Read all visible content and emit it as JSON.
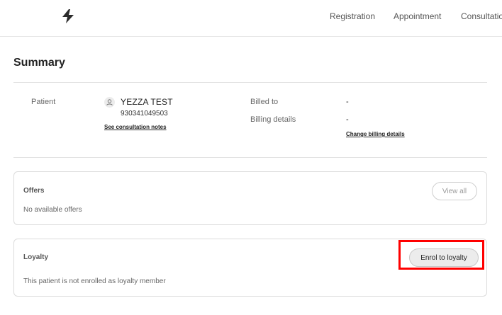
{
  "header": {
    "logo_icon": "lightning-bolt-icon",
    "nav": [
      "Registration",
      "Appointment",
      "Consultation"
    ]
  },
  "summary": {
    "title": "Summary",
    "patient_label": "Patient",
    "patient_name": "YEZZA TEST",
    "patient_id": "930341049503",
    "consultation_link": "See consultation notes",
    "billed_to_label": "Billed to",
    "billed_to_value": "-",
    "billing_details_label": "Billing details",
    "billing_details_value": "-",
    "change_billing_link": "Change billing details"
  },
  "offers": {
    "title": "Offers",
    "button": "View all",
    "empty_text": "No available offers"
  },
  "loyalty": {
    "title": "Loyalty",
    "button": "Enrol to loyalty",
    "status_text": "This patient is not enrolled as loyalty member"
  },
  "colors": {
    "highlight": "#ff0000",
    "border": "#dcdcdc"
  }
}
